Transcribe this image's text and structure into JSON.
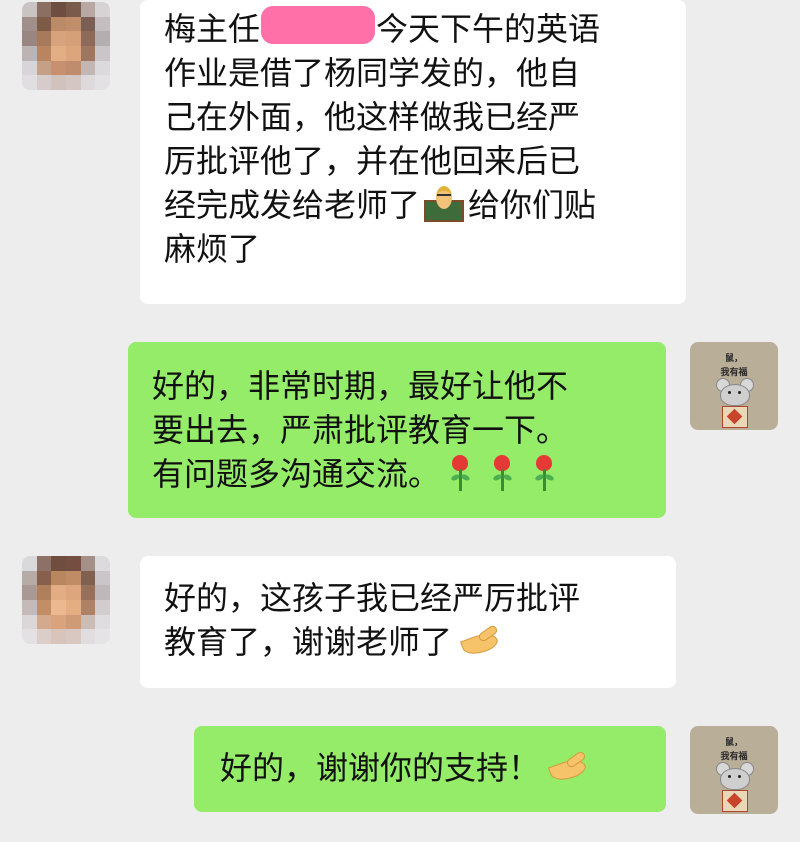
{
  "chat": {
    "messages": [
      {
        "id": "m1",
        "side": "in",
        "lines": [
          "梅主任",
          "今天下午的英语",
          "作业是借了杨同学发的，他自",
          "己在外面，他这样做我已经严",
          "厉批评他了，并在他回来后已",
          "经完成发给老师了",
          "给你们贴",
          "麻烦了"
        ],
        "emoji": [
          "teacher"
        ]
      },
      {
        "id": "m2",
        "side": "out",
        "lines": [
          "好的，非常时期，最好让他不",
          "要出去，严肃批评教育一下。",
          "有问题多沟通交流。"
        ],
        "emoji": [
          "rose",
          "rose",
          "rose"
        ]
      },
      {
        "id": "m3",
        "side": "in",
        "lines": [
          "好的，这孩子我已经严厉批评",
          "教育了，谢谢老师了"
        ],
        "emoji": [
          "ok-hand"
        ]
      },
      {
        "id": "m4",
        "side": "out",
        "lines": [
          "好的，谢谢你的支持！"
        ],
        "emoji": [
          "ok-hand"
        ]
      }
    ]
  },
  "sticker_avatar": {
    "line1": "鼠，",
    "line2": "我有福"
  },
  "colors": {
    "background": "#ededed",
    "bubble_in": "#ffffff",
    "bubble_out": "#95ec69",
    "redaction": "#ff6fa8"
  }
}
